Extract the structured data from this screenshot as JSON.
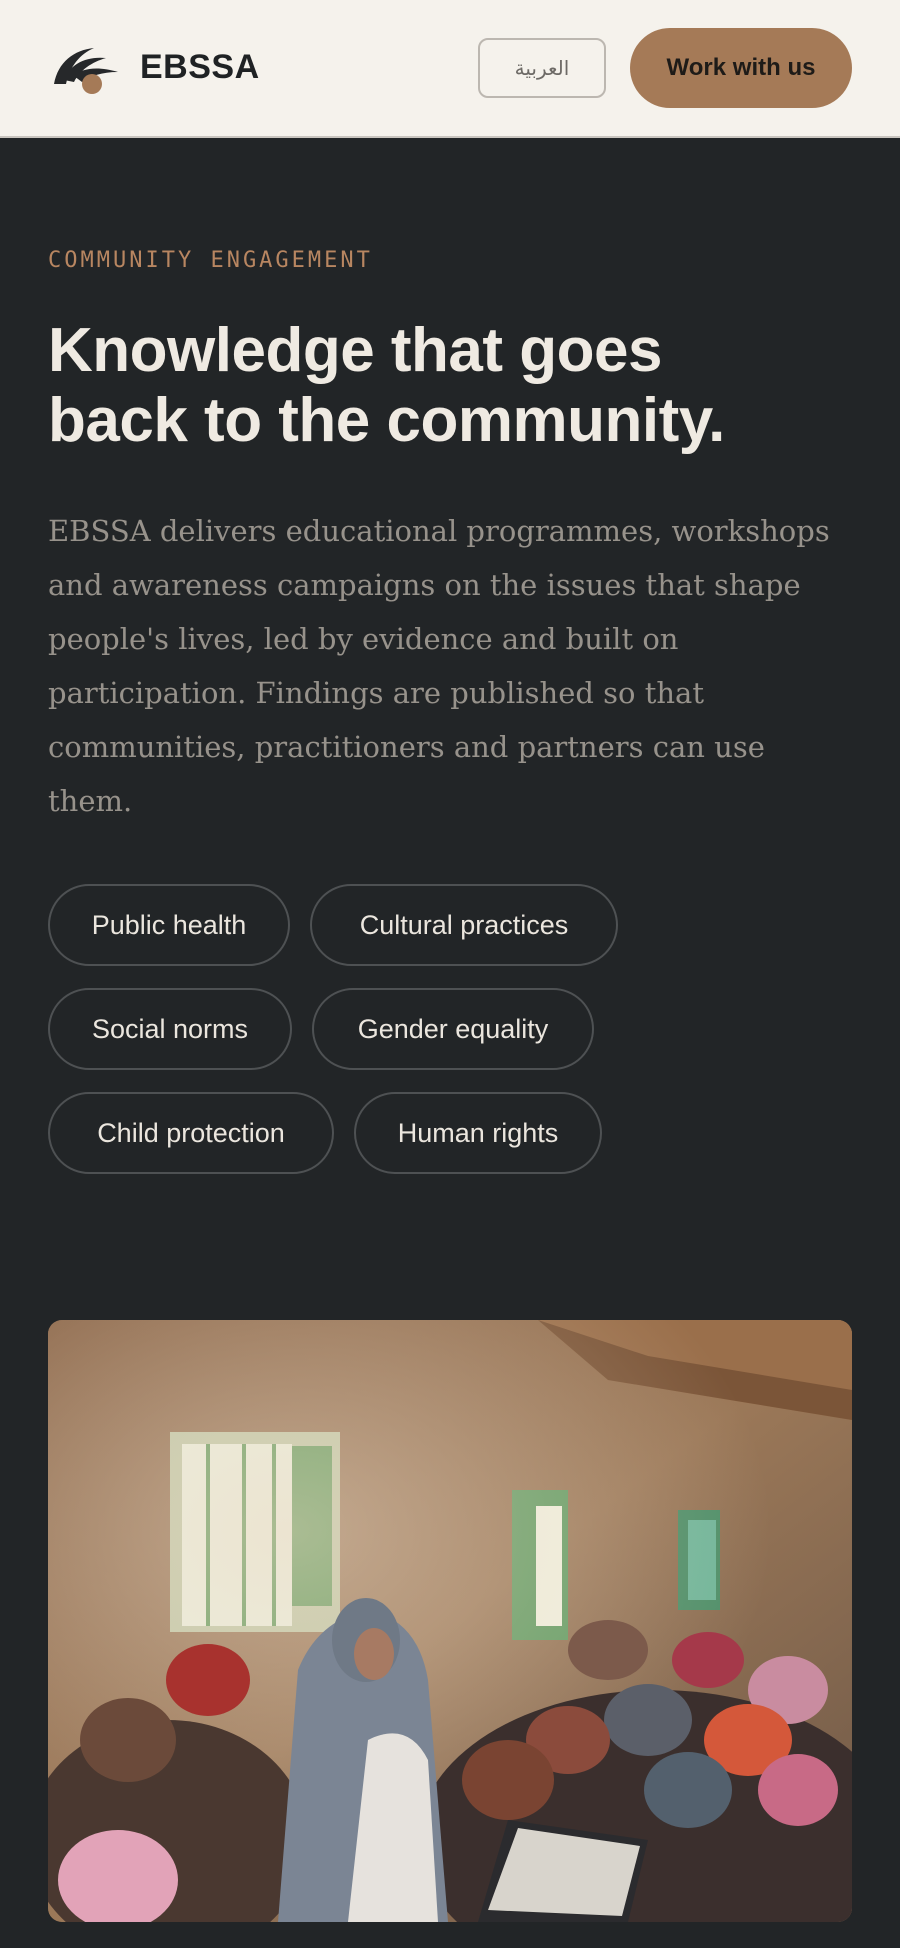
{
  "header": {
    "brand": "EBSSA",
    "language_button": "العربية",
    "cta_label": "Work with us",
    "logo_icon": "ebssa-logo-icon"
  },
  "hero": {
    "eyebrow": "COMMUNITY ENGAGEMENT",
    "headline_line1": "Knowledge that goes",
    "headline_line2": "back to the community.",
    "intro": "EBSSA delivers educational programmes, workshops and awareness campaigns on the issues that shape people's lives, led by evidence and built on participation. Findings are published so that communities, practitioners and partners can use them."
  },
  "topics": [
    "Public health",
    "Cultural practices",
    "Social norms",
    "Gender equality",
    "Child protection",
    "Human rights"
  ],
  "colors": {
    "background": "#222527",
    "header_bg": "#f5f2ec",
    "accent": "#a57a57",
    "eyebrow": "#b88661"
  }
}
